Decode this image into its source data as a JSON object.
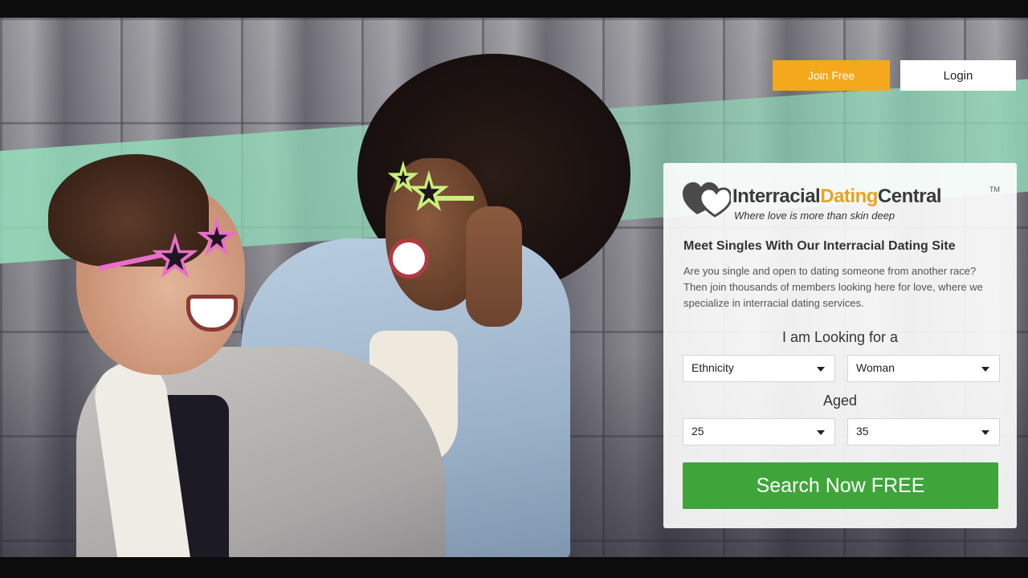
{
  "header": {
    "join_label": "Join Free",
    "login_label": "Login"
  },
  "brand": {
    "name_part_a": "Interracial",
    "name_part_b": "Dating",
    "name_part_c": "Central",
    "trademark": "TM",
    "tagline": "Where love is more than skin deep",
    "color_accent": "#e8a322",
    "color_dark": "#3a3a3a"
  },
  "panel": {
    "heading": "Meet Singles With Our Interracial Dating Site",
    "description": "Are you single and open to dating someone from another race? Then join thousands of members looking here for love, where we specialize in interracial dating services.",
    "looking_label": "I am Looking for a",
    "ethnicity_value": "Ethnicity",
    "gender_value": "Woman",
    "aged_label": "Aged",
    "age_min_value": "25",
    "age_max_value": "35",
    "search_label": "Search Now FREE"
  },
  "colors": {
    "join_button": "#f3a91b",
    "search_button": "#3fa53a"
  },
  "icons": [
    "hearts-logo-icon",
    "caret-down-icon"
  ]
}
